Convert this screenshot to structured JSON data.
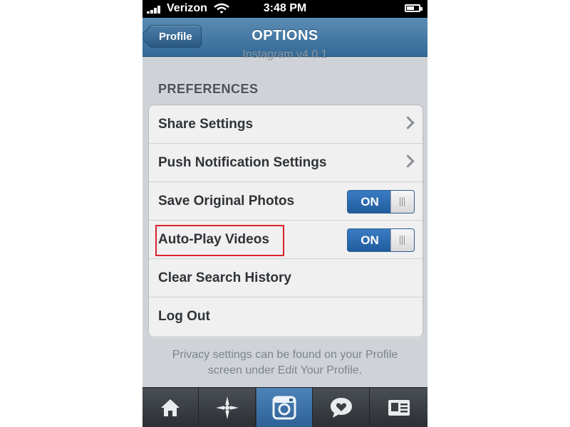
{
  "status_bar": {
    "carrier": "Verizon",
    "time": "3:48 PM"
  },
  "nav": {
    "back_label": "Profile",
    "title": "OPTIONS"
  },
  "version_text": "Instagram v4.0.1",
  "preferences": {
    "header": "PREFERENCES",
    "rows": [
      {
        "label": "Share Settings"
      },
      {
        "label": "Push Notification Settings"
      },
      {
        "label": "Save Original Photos",
        "toggle": "ON"
      },
      {
        "label": "Auto-Play Videos",
        "toggle": "ON"
      },
      {
        "label": "Clear Search History"
      },
      {
        "label": "Log Out"
      }
    ]
  },
  "footer_note": "Privacy settings can be found on your Profile screen under Edit Your Profile.",
  "tabbar": {
    "tabs": [
      "home-icon",
      "explore-icon",
      "camera-icon",
      "activity-icon",
      "profile-icon"
    ],
    "active_index": 2
  },
  "colors": {
    "nav_blue": "#336a96",
    "toggle_blue": "#2d6bb0",
    "highlight_red": "#d8232a"
  }
}
